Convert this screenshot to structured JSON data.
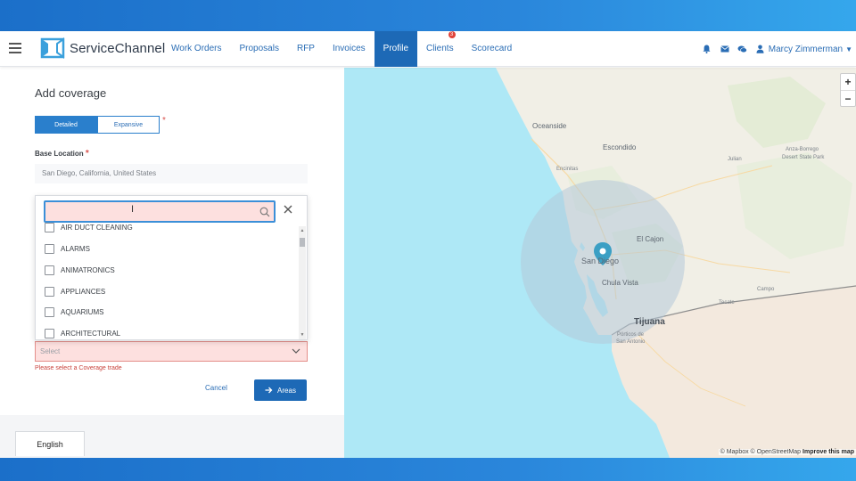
{
  "nav": {
    "logo_text": "ServiceChannel",
    "items": [
      {
        "label": "Work Orders"
      },
      {
        "label": "Proposals"
      },
      {
        "label": "RFP"
      },
      {
        "label": "Invoices"
      },
      {
        "label": "Profile",
        "active": true
      },
      {
        "label": "Clients",
        "badge": "3"
      },
      {
        "label": "Scorecard"
      }
    ],
    "user_name": "Marcy Zimmerman",
    "icons": [
      "bell-icon",
      "mail-icon",
      "chat-icon",
      "user-icon"
    ]
  },
  "form": {
    "title": "Add coverage",
    "segmented": {
      "options": [
        "Detailed",
        "Expansive"
      ],
      "selected": "Detailed"
    },
    "base_location_label": "Base Location",
    "base_location_value": "San Diego, California, United States",
    "trade_dropdown": {
      "search_value": "",
      "items": [
        "AIR DUCT CLEANING",
        "ALARMS",
        "ANIMATRONICS",
        "APPLIANCES",
        "AQUARIUMS",
        "ARCHITECTURAL"
      ]
    },
    "trade_select_placeholder": "Select",
    "error_message": "Please select a Coverage trade",
    "cancel_label": "Cancel",
    "areas_label": "Areas"
  },
  "language": "English",
  "map": {
    "labels": {
      "oceanside": "Oceanside",
      "escondido": "Escondido",
      "encinitas": "Encinitas",
      "julian": "Julian",
      "anza_borrego": "Anza-Borrego",
      "desert_state_park": "Desert State Park",
      "el_cajon": "El Cajon",
      "san_diego": "San Diego",
      "chula_vista": "Chula Vista",
      "campo": "Campo",
      "tecate": "Tecate",
      "tijuana": "Tijuana",
      "porticos_1": "Pórticos de",
      "porticos_2": "San Antonio"
    },
    "zoom_in": "+",
    "zoom_out": "−",
    "attribution_plain": "© Mapbox © OpenStreetMap",
    "attribution_link": "Improve this map",
    "colors": {
      "water": "#aee8f6",
      "land": "#f1efe6",
      "mexico": "#f3e9de",
      "radius": "#b4c8d8",
      "pin": "#3b9fc4"
    }
  }
}
